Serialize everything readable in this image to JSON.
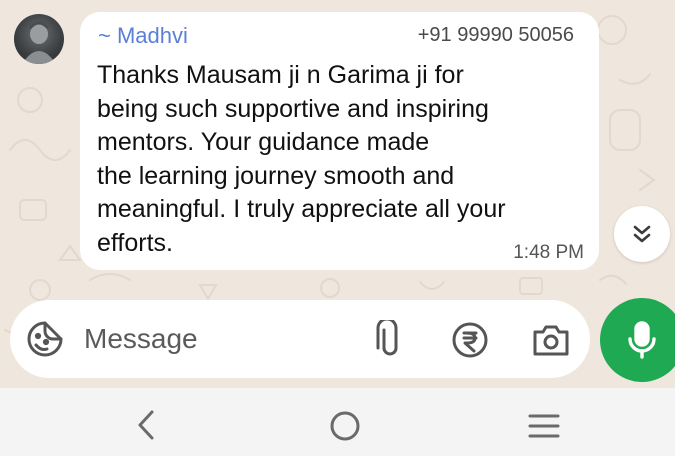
{
  "message": {
    "sender_name": "~ Madhvi",
    "sender_phone": "+91 99990 50056",
    "text": "Thanks Mausam ji n Garima ji for\nbeing such  supportive and inspiring\nmentors. Your guidance made\nthe learning journey smooth and\nmeaningful. I truly appreciate all your\nefforts.",
    "time": "1:48 PM"
  },
  "composer": {
    "placeholder": "Message"
  },
  "icons": {
    "emoji": "sticker-emoji-icon",
    "attach": "paperclip-icon",
    "payment": "rupee-icon",
    "camera": "camera-icon",
    "mic": "mic-icon",
    "scroll": "double-chevron-down-icon",
    "nav_back": "back-icon",
    "nav_home": "home-icon",
    "nav_recents": "recents-icon"
  },
  "colors": {
    "chat_background": "#efe7dd",
    "bubble": "#ffffff",
    "sender_name": "#5b7fd6",
    "mic_button": "#1ea952",
    "nav_bar": "#f4f4f5"
  }
}
